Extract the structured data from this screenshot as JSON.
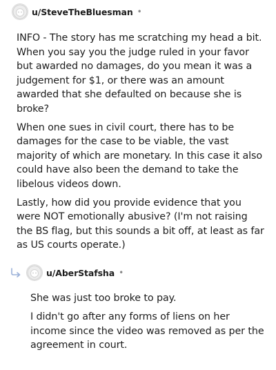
{
  "comment": {
    "username": "u/SteveTheBluesman",
    "separator": "•",
    "paragraphs": [
      "INFO - The story has me scratching my head a bit. When you say you the judge ruled in your favor but awarded no damages, do you mean it was a judgement for $1, or there was an amount awarded that she defaulted on because she is broke?",
      "When one sues in civil court, there has to be damages for the case to be viable, the vast majority of which are monetary. In this case it also could have also been the demand to take the libelous videos down.",
      "Lastly, how did you provide evidence that you were NOT emotionally abusive? (I'm not raising the BS flag, but this sounds a bit off, at least as far as US courts operate.)"
    ]
  },
  "reply": {
    "username": "u/AberStafsha",
    "separator": "•",
    "paragraphs": [
      "She was just too broke to pay.",
      "I didn't go after any forms of liens on her income since the video was removed as per the agreement in court."
    ]
  },
  "icons": {
    "avatar": "default-avatar-icon",
    "reply": "reply-arrow-icon"
  },
  "colors": {
    "text": "#1c1c1c",
    "muted": "#888888",
    "reply_arrow": "#9ab0d8"
  }
}
